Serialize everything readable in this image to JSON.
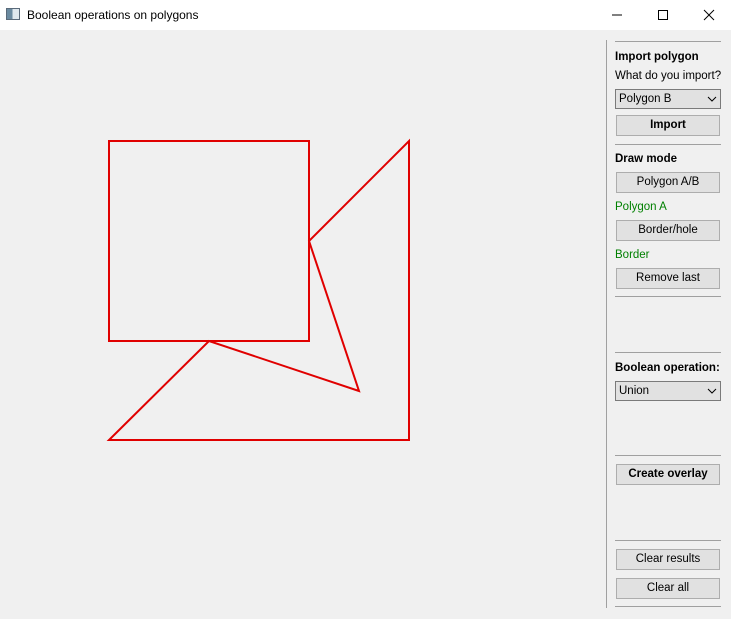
{
  "window": {
    "title": "Boolean operations on polygons"
  },
  "import": {
    "heading": "Import polygon",
    "question": "What do you import?",
    "selected": "Polygon B",
    "import_button": "Import"
  },
  "draw": {
    "heading": "Draw mode",
    "polygon_button": "Polygon A/B",
    "polygon_state": "Polygon A",
    "border_button": "Border/hole",
    "border_state": "Border",
    "remove_button": "Remove last"
  },
  "boolean": {
    "heading": "Boolean operation:",
    "selected": "Union",
    "overlay_button": "Create overlay"
  },
  "results": {
    "clear_results_button": "Clear results",
    "clear_all_button": "Clear all"
  },
  "colors": {
    "polygon_stroke": "#e00000",
    "state_text": "#008000"
  },
  "icons": {
    "app": "app-icon",
    "minimize": "minimize-icon",
    "maximize": "maximize-icon",
    "close": "close-icon",
    "dropdown": "chevron-down-icon"
  }
}
